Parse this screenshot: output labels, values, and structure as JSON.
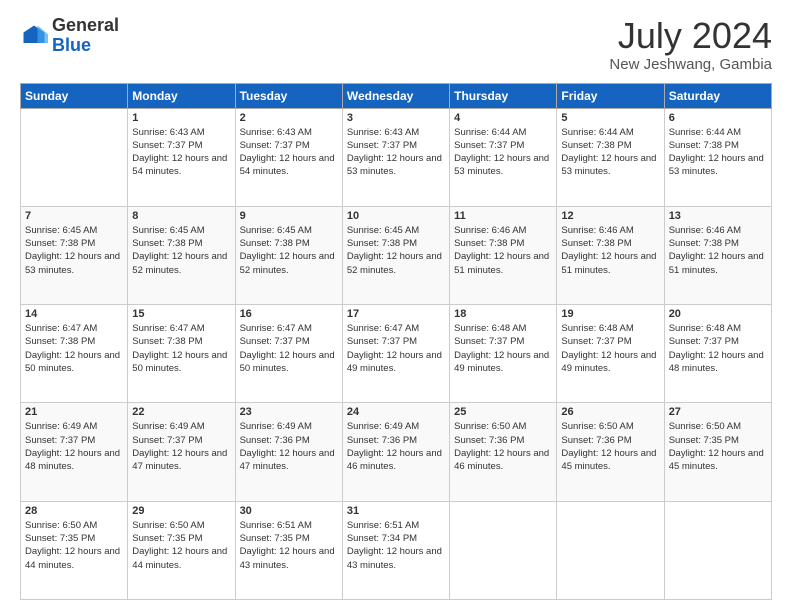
{
  "header": {
    "logo_general": "General",
    "logo_blue": "Blue",
    "month_title": "July 2024",
    "location": "New Jeshwang, Gambia"
  },
  "weekdays": [
    "Sunday",
    "Monday",
    "Tuesday",
    "Wednesday",
    "Thursday",
    "Friday",
    "Saturday"
  ],
  "weeks": [
    [
      {
        "day": "",
        "sunrise": "",
        "sunset": "",
        "daylight": ""
      },
      {
        "day": "1",
        "sunrise": "Sunrise: 6:43 AM",
        "sunset": "Sunset: 7:37 PM",
        "daylight": "Daylight: 12 hours and 54 minutes."
      },
      {
        "day": "2",
        "sunrise": "Sunrise: 6:43 AM",
        "sunset": "Sunset: 7:37 PM",
        "daylight": "Daylight: 12 hours and 54 minutes."
      },
      {
        "day": "3",
        "sunrise": "Sunrise: 6:43 AM",
        "sunset": "Sunset: 7:37 PM",
        "daylight": "Daylight: 12 hours and 53 minutes."
      },
      {
        "day": "4",
        "sunrise": "Sunrise: 6:44 AM",
        "sunset": "Sunset: 7:37 PM",
        "daylight": "Daylight: 12 hours and 53 minutes."
      },
      {
        "day": "5",
        "sunrise": "Sunrise: 6:44 AM",
        "sunset": "Sunset: 7:38 PM",
        "daylight": "Daylight: 12 hours and 53 minutes."
      },
      {
        "day": "6",
        "sunrise": "Sunrise: 6:44 AM",
        "sunset": "Sunset: 7:38 PM",
        "daylight": "Daylight: 12 hours and 53 minutes."
      }
    ],
    [
      {
        "day": "7",
        "sunrise": "Sunrise: 6:45 AM",
        "sunset": "Sunset: 7:38 PM",
        "daylight": "Daylight: 12 hours and 53 minutes."
      },
      {
        "day": "8",
        "sunrise": "Sunrise: 6:45 AM",
        "sunset": "Sunset: 7:38 PM",
        "daylight": "Daylight: 12 hours and 52 minutes."
      },
      {
        "day": "9",
        "sunrise": "Sunrise: 6:45 AM",
        "sunset": "Sunset: 7:38 PM",
        "daylight": "Daylight: 12 hours and 52 minutes."
      },
      {
        "day": "10",
        "sunrise": "Sunrise: 6:45 AM",
        "sunset": "Sunset: 7:38 PM",
        "daylight": "Daylight: 12 hours and 52 minutes."
      },
      {
        "day": "11",
        "sunrise": "Sunrise: 6:46 AM",
        "sunset": "Sunset: 7:38 PM",
        "daylight": "Daylight: 12 hours and 51 minutes."
      },
      {
        "day": "12",
        "sunrise": "Sunrise: 6:46 AM",
        "sunset": "Sunset: 7:38 PM",
        "daylight": "Daylight: 12 hours and 51 minutes."
      },
      {
        "day": "13",
        "sunrise": "Sunrise: 6:46 AM",
        "sunset": "Sunset: 7:38 PM",
        "daylight": "Daylight: 12 hours and 51 minutes."
      }
    ],
    [
      {
        "day": "14",
        "sunrise": "Sunrise: 6:47 AM",
        "sunset": "Sunset: 7:38 PM",
        "daylight": "Daylight: 12 hours and 50 minutes."
      },
      {
        "day": "15",
        "sunrise": "Sunrise: 6:47 AM",
        "sunset": "Sunset: 7:38 PM",
        "daylight": "Daylight: 12 hours and 50 minutes."
      },
      {
        "day": "16",
        "sunrise": "Sunrise: 6:47 AM",
        "sunset": "Sunset: 7:37 PM",
        "daylight": "Daylight: 12 hours and 50 minutes."
      },
      {
        "day": "17",
        "sunrise": "Sunrise: 6:47 AM",
        "sunset": "Sunset: 7:37 PM",
        "daylight": "Daylight: 12 hours and 49 minutes."
      },
      {
        "day": "18",
        "sunrise": "Sunrise: 6:48 AM",
        "sunset": "Sunset: 7:37 PM",
        "daylight": "Daylight: 12 hours and 49 minutes."
      },
      {
        "day": "19",
        "sunrise": "Sunrise: 6:48 AM",
        "sunset": "Sunset: 7:37 PM",
        "daylight": "Daylight: 12 hours and 49 minutes."
      },
      {
        "day": "20",
        "sunrise": "Sunrise: 6:48 AM",
        "sunset": "Sunset: 7:37 PM",
        "daylight": "Daylight: 12 hours and 48 minutes."
      }
    ],
    [
      {
        "day": "21",
        "sunrise": "Sunrise: 6:49 AM",
        "sunset": "Sunset: 7:37 PM",
        "daylight": "Daylight: 12 hours and 48 minutes."
      },
      {
        "day": "22",
        "sunrise": "Sunrise: 6:49 AM",
        "sunset": "Sunset: 7:37 PM",
        "daylight": "Daylight: 12 hours and 47 minutes."
      },
      {
        "day": "23",
        "sunrise": "Sunrise: 6:49 AM",
        "sunset": "Sunset: 7:36 PM",
        "daylight": "Daylight: 12 hours and 47 minutes."
      },
      {
        "day": "24",
        "sunrise": "Sunrise: 6:49 AM",
        "sunset": "Sunset: 7:36 PM",
        "daylight": "Daylight: 12 hours and 46 minutes."
      },
      {
        "day": "25",
        "sunrise": "Sunrise: 6:50 AM",
        "sunset": "Sunset: 7:36 PM",
        "daylight": "Daylight: 12 hours and 46 minutes."
      },
      {
        "day": "26",
        "sunrise": "Sunrise: 6:50 AM",
        "sunset": "Sunset: 7:36 PM",
        "daylight": "Daylight: 12 hours and 45 minutes."
      },
      {
        "day": "27",
        "sunrise": "Sunrise: 6:50 AM",
        "sunset": "Sunset: 7:35 PM",
        "daylight": "Daylight: 12 hours and 45 minutes."
      }
    ],
    [
      {
        "day": "28",
        "sunrise": "Sunrise: 6:50 AM",
        "sunset": "Sunset: 7:35 PM",
        "daylight": "Daylight: 12 hours and 44 minutes."
      },
      {
        "day": "29",
        "sunrise": "Sunrise: 6:50 AM",
        "sunset": "Sunset: 7:35 PM",
        "daylight": "Daylight: 12 hours and 44 minutes."
      },
      {
        "day": "30",
        "sunrise": "Sunrise: 6:51 AM",
        "sunset": "Sunset: 7:35 PM",
        "daylight": "Daylight: 12 hours and 43 minutes."
      },
      {
        "day": "31",
        "sunrise": "Sunrise: 6:51 AM",
        "sunset": "Sunset: 7:34 PM",
        "daylight": "Daylight: 12 hours and 43 minutes."
      },
      {
        "day": "",
        "sunrise": "",
        "sunset": "",
        "daylight": ""
      },
      {
        "day": "",
        "sunrise": "",
        "sunset": "",
        "daylight": ""
      },
      {
        "day": "",
        "sunrise": "",
        "sunset": "",
        "daylight": ""
      }
    ]
  ]
}
